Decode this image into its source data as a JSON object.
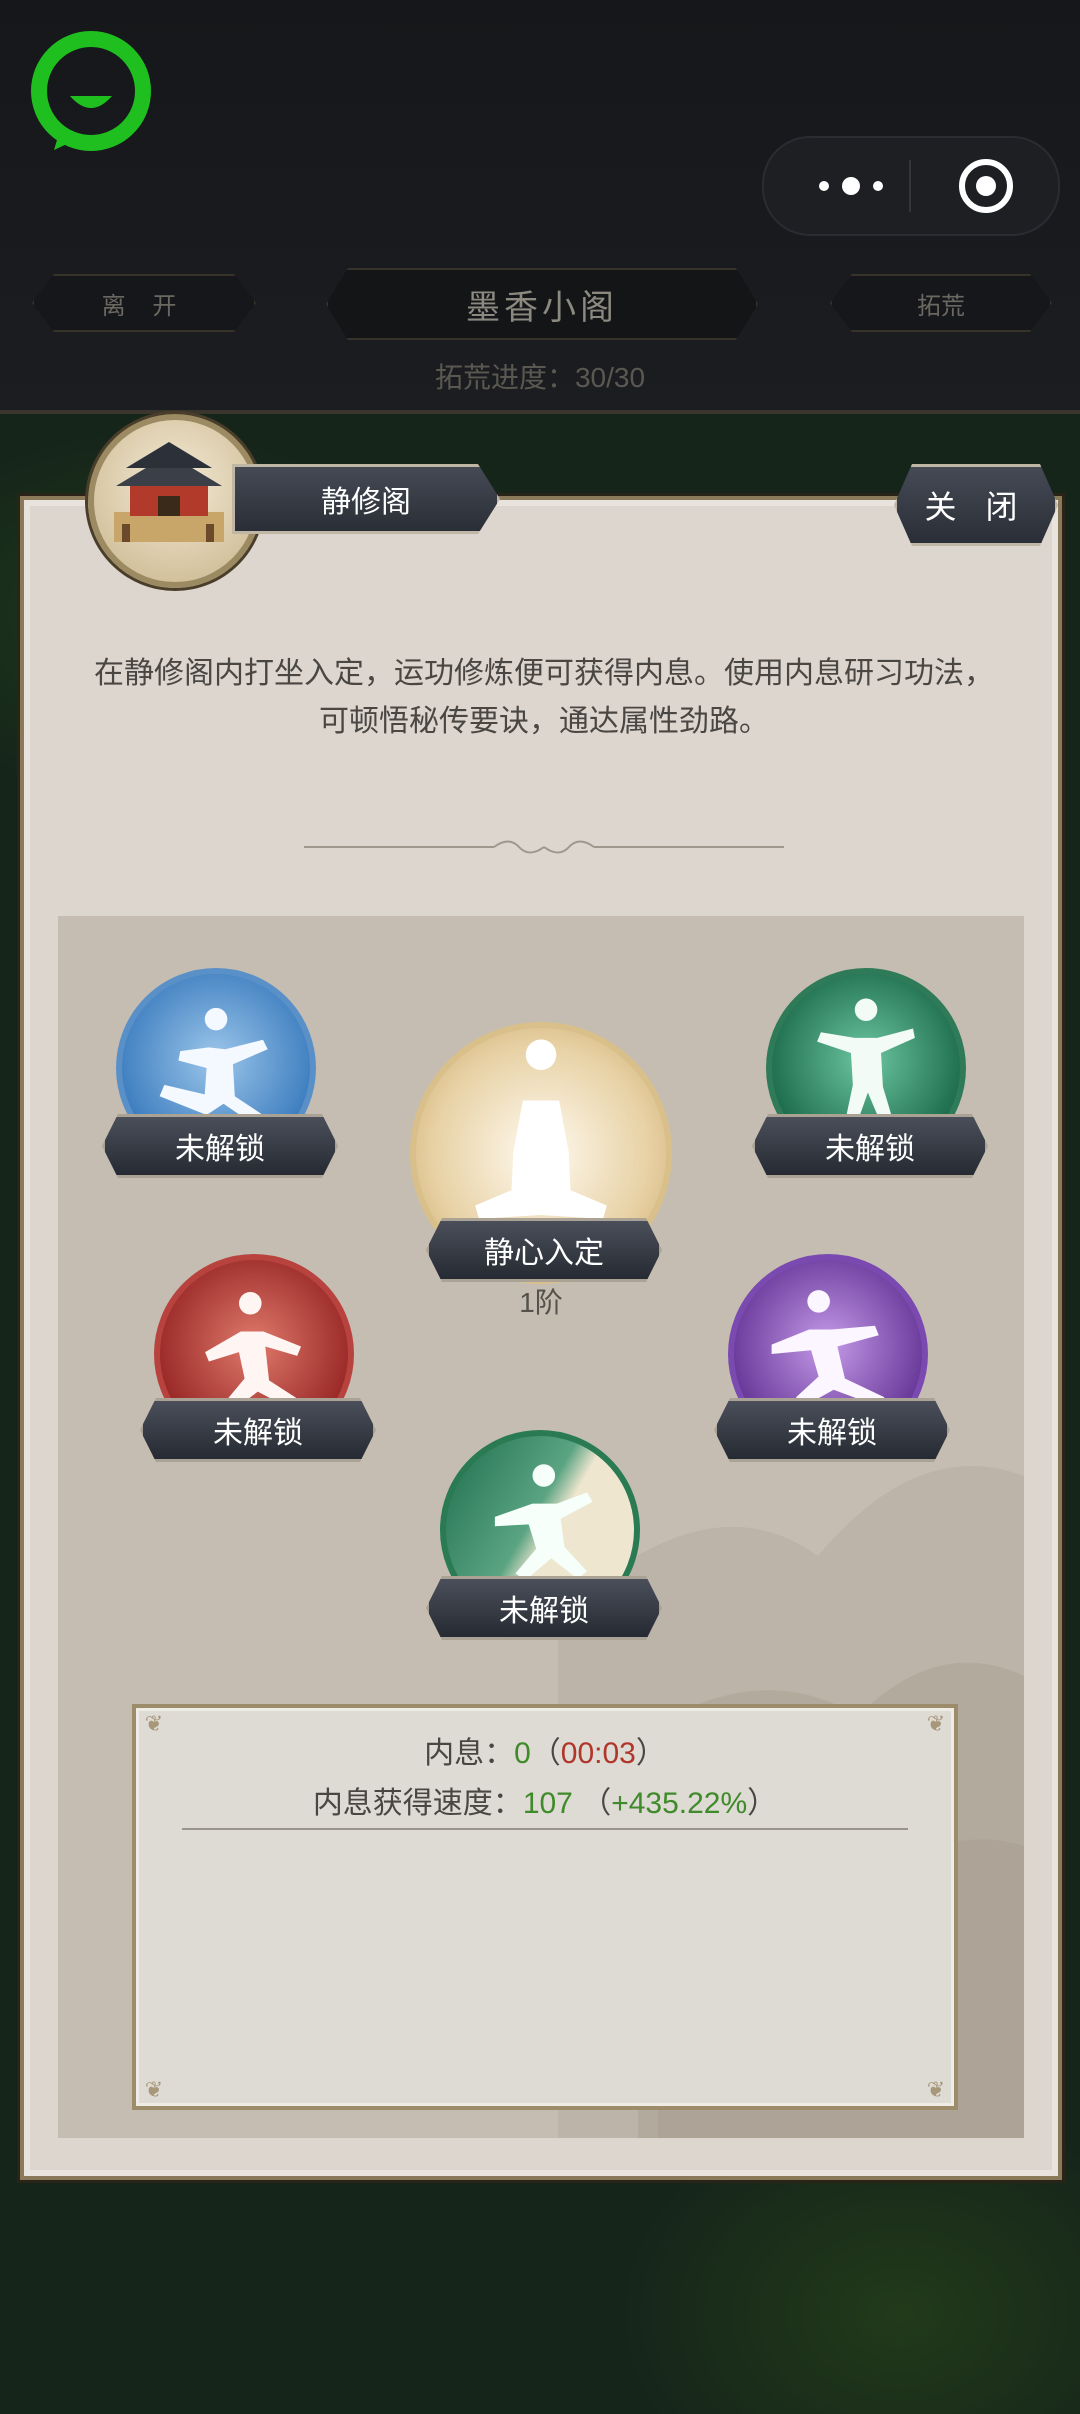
{
  "top_bar": {
    "leave_label": "离 开",
    "location_title": "墨香小阁",
    "explore_label": "拓荒",
    "progress_text": "拓荒进度：30/30"
  },
  "panel": {
    "building_name": "静修阁",
    "close_label": "关 闭",
    "description": "在静修阁内打坐入定，运功修炼便可获得内息。使用内息研习功法，可顿悟秘传要诀，通达属性劲路。"
  },
  "skills": [
    {
      "label": "未解锁",
      "color": "#3f7fc0"
    },
    {
      "label": "未解锁",
      "color": "#1f6e4e"
    },
    {
      "label": "静心入定",
      "level": "1阶",
      "color": "#d8bb86"
    },
    {
      "label": "未解锁",
      "color": "#9a2a28"
    },
    {
      "label": "未解锁",
      "color": "#6a3a9a"
    },
    {
      "label": "未解锁",
      "color": "#2a6a50"
    }
  ],
  "info": {
    "neixi_label": "内息：",
    "neixi_value": "0",
    "neixi_paren_open": "（",
    "neixi_timer": "00:03",
    "neixi_paren_close": "）",
    "speed_label": "内息获得速度：",
    "speed_value": "107",
    "speed_paren_open": " （",
    "speed_bonus": "+435.22%",
    "speed_paren_close": "）"
  },
  "icons": [
    "wechat-logo-icon",
    "more-dots-icon",
    "target-close-icon",
    "building-icon"
  ]
}
